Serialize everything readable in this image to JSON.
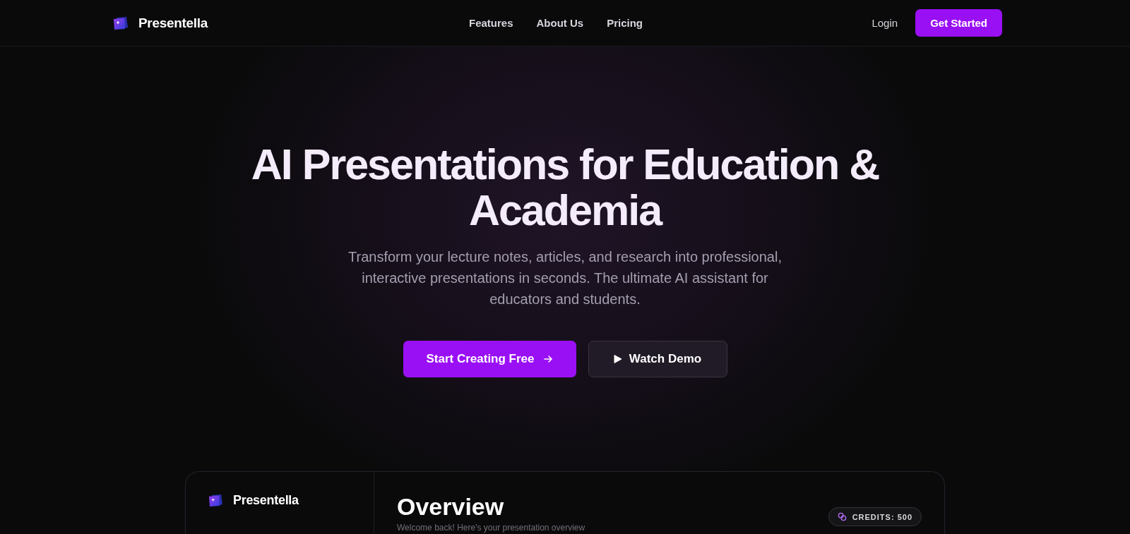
{
  "header": {
    "brand": "Presentella",
    "nav": [
      {
        "label": "Features"
      },
      {
        "label": "About Us"
      },
      {
        "label": "Pricing"
      }
    ],
    "login": "Login",
    "cta": "Get Started"
  },
  "hero": {
    "title": "AI Presentations for Education & Academia",
    "subtitle": "Transform your lecture notes, articles, and research into professional, interactive presentations in seconds. The ultimate AI assistant for educators and students.",
    "primary": "Start Creating Free",
    "secondary": "Watch Demo"
  },
  "dashboard": {
    "brand": "Presentella",
    "title": "Overview",
    "subtitle": "Welcome back! Here's your presentation overview",
    "credits": "CREDITS: 500"
  }
}
